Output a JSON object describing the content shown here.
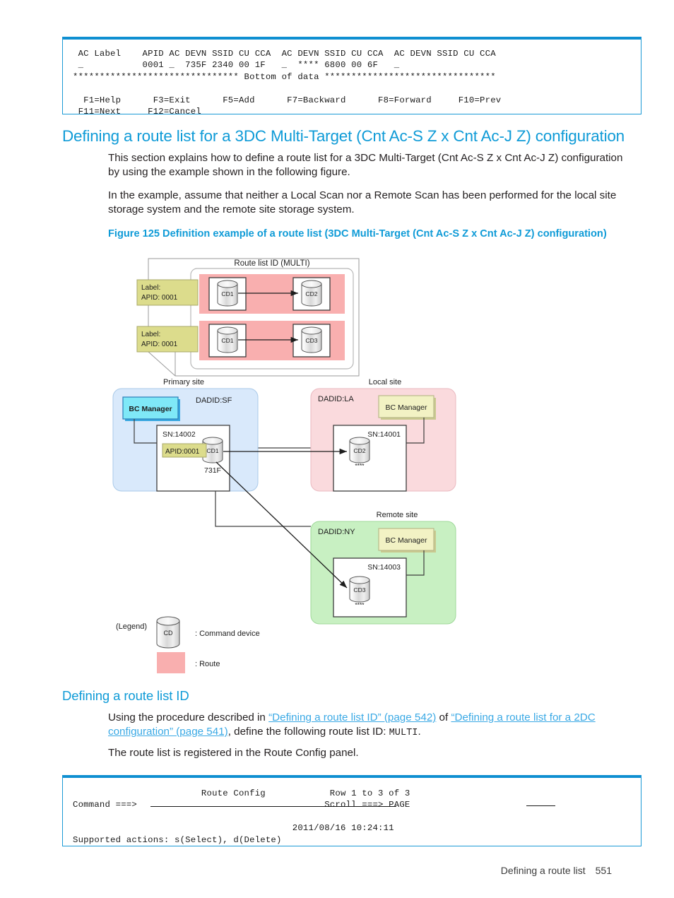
{
  "terminal_top": {
    "name": "ac-label-panel",
    "lines": [
      " AC Label    APID AC DEVN SSID CU CCA  AC DEVN SSID CU CCA  AC DEVN SSID CU CCA",
      " _           0001 _  735F 2340 00 1F   _  **** 6800 00 6F   _",
      "******************************* Bottom of data ********************************",
      "",
      "  F1=Help      F3=Exit      F5=Add      F7=Backward      F8=Forward     F10=Prev",
      " F11=Next     F12=Cancel"
    ]
  },
  "section": {
    "heading": "Defining a route list for a 3DC Multi-Target (Cnt Ac-S Z x Cnt Ac-J Z) configuration",
    "para1": "This section explains how to define a route list for a 3DC Multi-Target (Cnt Ac-S Z x Cnt Ac-J Z) configuration by using the example shown in the following figure.",
    "para2": "In the example, assume that neither a Local Scan nor a Remote Scan has been performed for the local site storage system and the remote site storage system."
  },
  "figure": {
    "caption": "Figure 125 Definition example of a route list (3DC Multi-Target (Cnt Ac-S Z x Cnt Ac-J Z) configuration)",
    "route_list_title": "Route list ID (MULTI)",
    "routes": [
      {
        "label_line1": "Label:",
        "label_line2": "APID: 0001",
        "from": "CD1",
        "to": "CD2"
      },
      {
        "label_line1": "Label:",
        "label_line2": "APID: 0001",
        "from": "CD1",
        "to": "CD3"
      }
    ],
    "sites": [
      {
        "title": "Primary site",
        "dadid": "DADID:SF",
        "bc_manager": "BC Manager",
        "sn": "SN:14002",
        "device": "CD1",
        "apid": "APID:0001",
        "devn": "731F",
        "stars": ""
      },
      {
        "title": "Local site",
        "dadid": "DADID:LA",
        "bc_manager": "BC Manager",
        "sn": "SN:14001",
        "device": "CD2",
        "apid": "",
        "devn": "",
        "stars": "****"
      },
      {
        "title": "Remote site",
        "dadid": "DADID:NY",
        "bc_manager": "BC Manager",
        "sn": "SN:14003",
        "device": "CD3",
        "apid": "",
        "devn": "",
        "stars": "****"
      }
    ],
    "legend": {
      "title": "(Legend)",
      "device_glyph": "CD",
      "device_text": ": Command device",
      "route_text": ": Route"
    },
    "colors": {
      "primary_site_fill": "#d9e9fb",
      "local_site_fill": "#fadadd",
      "remote_site_fill": "#c8f0c2",
      "route_fill": "#f9afaf",
      "label_fill": "#dcdc8c",
      "bc_primary_fill": "#7fe8f7",
      "bc_other_fill": "#f2f2c4",
      "accent": "#0f9bd7"
    }
  },
  "subsection": {
    "heading": "Defining a route list ID",
    "para_a_pre": "Using the procedure described in ",
    "para_a_link1": "“Defining a route list ID” (page 542)",
    "para_a_mid": " of ",
    "para_a_link2": "“Defining a route list for a 2DC configuration” (page 541)",
    "para_a_post": ", define the following route list ID: ",
    "para_a_mono": "MULTI",
    "para_a_end": ".",
    "para_b": "The route list is registered in the Route Config panel."
  },
  "terminal_bottom": {
    "name": "route-config-panel",
    "lines": [
      "                        Route Config            Row 1 to 3 of 3",
      "Command ===>                                   Scroll ===> PAGE",
      "",
      "                                         2011/08/16 10:24:11",
      "Supported actions: s(Select), d(Delete)"
    ]
  },
  "footer": {
    "label": "Defining a route list",
    "page": "551"
  }
}
